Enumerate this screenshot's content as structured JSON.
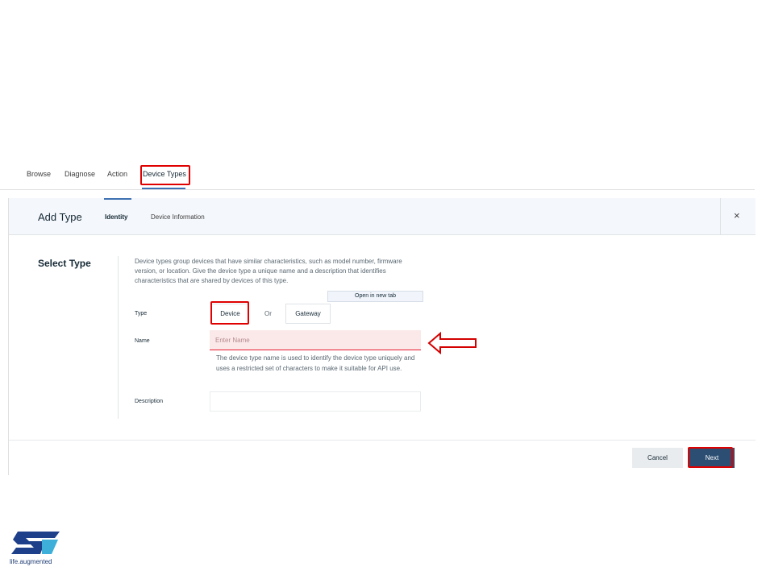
{
  "nav": {
    "tabs": [
      {
        "label": "Browse"
      },
      {
        "label": "Diagnose"
      },
      {
        "label": "Action"
      },
      {
        "label": "Device Types"
      }
    ]
  },
  "panel": {
    "title": "Add Type",
    "steps": [
      {
        "label": "Identity"
      },
      {
        "label": "Device Information"
      }
    ],
    "close_icon": "×"
  },
  "form": {
    "section_title": "Select Type",
    "description": "Device types group devices that have similar characteristics, such as model number, firmware version, or location. Give the device type a unique name and a description that identifies characteristics that are shared by devices of this type.",
    "open_new_tab": "Open in new tab",
    "type_label": "Type",
    "type_options": [
      "Device",
      "Gateway"
    ],
    "or_text": "Or",
    "name_label": "Name",
    "name_placeholder": "Enter Name",
    "name_helper": "The device type name is used to identify the device type uniquely and uses a restricted set of characters to make it suitable for API use.",
    "description_label": "Description"
  },
  "footer": {
    "cancel_label": "Cancel",
    "next_label": "Next"
  },
  "branding": {
    "tagline": "life.augmented"
  },
  "colors": {
    "highlight": "#e00000",
    "primary_button": "#2c4e73",
    "error_field_bg": "#fbe9ea"
  },
  "icons": [
    "close-icon",
    "left-arrow-icon",
    "st-logo-icon"
  ]
}
